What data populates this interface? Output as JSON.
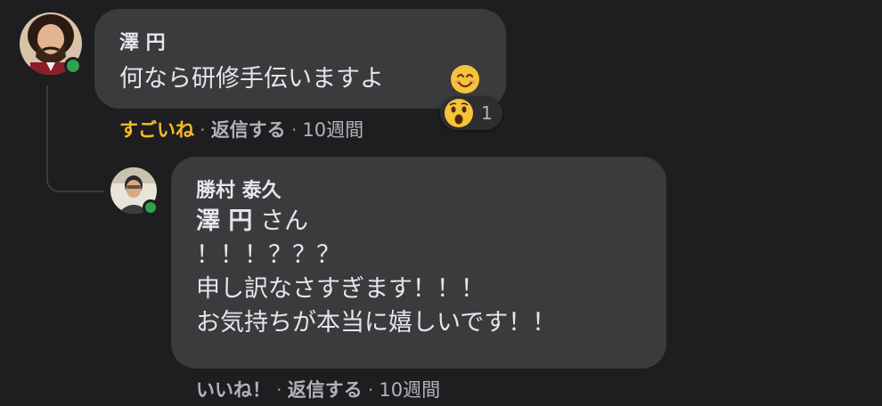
{
  "comment": {
    "author": "澤 円",
    "text": "何なら研修手伝いますよ",
    "actions": {
      "like": "すごいね",
      "reply": "返信する",
      "time": "10週間"
    },
    "reaction_count": "1",
    "icons": {
      "emoji": "smiling-face-icon",
      "reaction": "wow-reaction-icon"
    }
  },
  "reply": {
    "author": "勝村 泰久",
    "mention": "澤 円",
    "mention_suffix": " さん",
    "lines": [
      "！！！？？？",
      "申し訳なさすぎます！！！",
      "お気持ちが本当に嬉しいです！！"
    ],
    "actions": {
      "like": "いいね！",
      "reply": "返信する",
      "time": "10週間"
    }
  },
  "separator": "·",
  "colors": {
    "background": "#1e1e20",
    "bubble": "#3a3b3c",
    "text": "#e4e6eb",
    "liked": "#f7b928",
    "online": "#31a24c"
  }
}
